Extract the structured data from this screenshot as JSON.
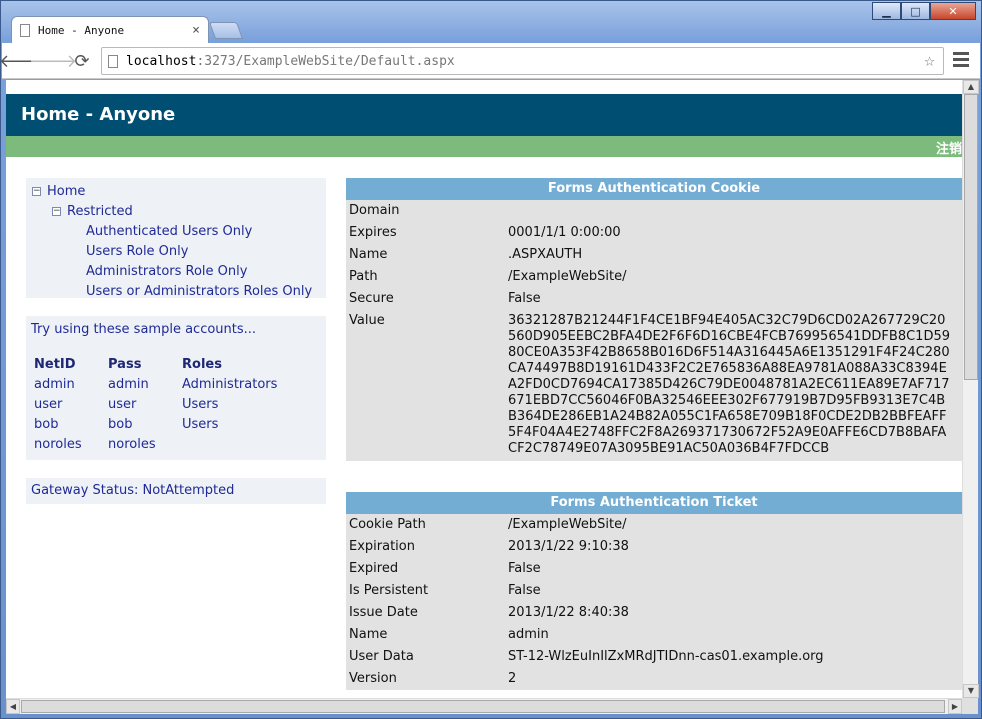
{
  "browser": {
    "tab_title": "Home - Anyone",
    "tab_close": "×",
    "url_host": "localhost",
    "url_rest": ":3273/ExampleWebSite/Default.aspx"
  },
  "page": {
    "title": "Home - Anyone",
    "logout": "注销"
  },
  "tree": {
    "home": "Home",
    "restricted": "Restricted",
    "items": [
      "Authenticated Users Only",
      "Users Role Only",
      "Administrators Role Only",
      "Users or Administrators Roles Only"
    ]
  },
  "samples": {
    "intro": "Try using these sample accounts...",
    "headers": [
      "NetID",
      "Pass",
      "Roles"
    ],
    "rows": [
      [
        "admin",
        "admin",
        "Administrators"
      ],
      [
        "user",
        "user",
        "Users"
      ],
      [
        "bob",
        "bob",
        "Users"
      ],
      [
        "noroles",
        "noroles",
        ""
      ]
    ]
  },
  "gateway": "Gateway Status: NotAttempted",
  "cookie": {
    "caption": "Forms Authentication Cookie",
    "rows": [
      {
        "k": "Domain",
        "v": ""
      },
      {
        "k": "Expires",
        "v": "0001/1/1 0:00:00"
      },
      {
        "k": "Name",
        "v": ".ASPXAUTH"
      },
      {
        "k": "Path",
        "v": "/ExampleWebSite/"
      },
      {
        "k": "Secure",
        "v": "False"
      },
      {
        "k": "Value",
        "v": "36321287B21244F1F4CE1BF94E405AC32C79D6CD02A267729C20560D905EEBC2BFA4DE2F6F6D16CBE4FCB769956541DDFB8C1D5980CE0A353F42B8658B016D6F514A316445A6E1351291F4F24C280CA74497B8D19161D433F2C2E765836A88EA9781A088A33C8394EA2FD0CD7694CA17385D426C79DE0048781A2EC611EA89E7AF717671EBD7CC56046F0BA32546EEE302F677919B7D95FB9313E7C4BB364DE286EB1A24B82A055C1FA658E709B18F0CDE2DB2BBFEAFF5F4F04A4E2748FFC2F8A269371730672F52A9E0AFFE6CD7B8BAFACF2C78749E07A3095BE91AC50A036B4F7FDCCB"
      }
    ]
  },
  "ticket": {
    "caption": "Forms Authentication Ticket",
    "rows": [
      {
        "k": "Cookie Path",
        "v": "/ExampleWebSite/"
      },
      {
        "k": "Expiration",
        "v": "2013/1/22 9:10:38"
      },
      {
        "k": "Expired",
        "v": "False"
      },
      {
        "k": "Is Persistent",
        "v": "False"
      },
      {
        "k": "Issue Date",
        "v": "2013/1/22 8:40:38"
      },
      {
        "k": "Name",
        "v": "admin"
      },
      {
        "k": "User Data",
        "v": "ST-12-WlzEuInIlZxMRdJTIDnn-cas01.example.org"
      },
      {
        "k": "Version",
        "v": "2"
      }
    ]
  },
  "icons": [
    "minimize-icon",
    "maximize-icon",
    "close-icon",
    "back-arrow-icon",
    "forward-arrow-icon",
    "reload-icon",
    "page-icon",
    "star-icon",
    "menu-icon",
    "collapse-icon"
  ]
}
